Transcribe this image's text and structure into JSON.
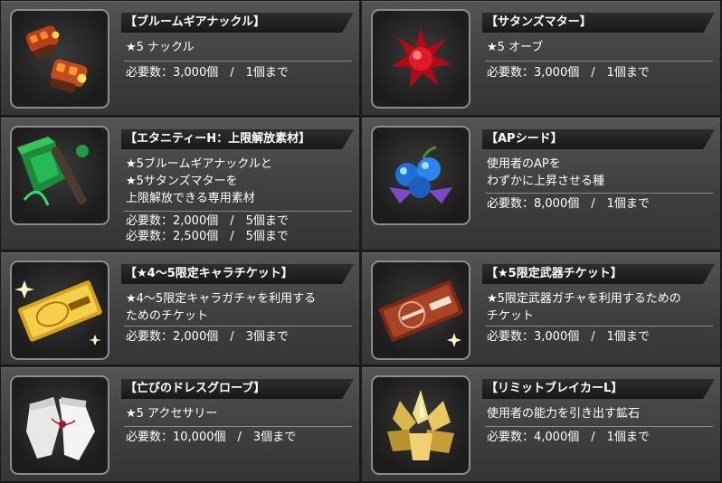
{
  "items": [
    {
      "title": "【ブルームギアナックル】",
      "description": "★5 ナックル",
      "requirements": [
        "必要数：3,000個　/　1個まで"
      ],
      "icon": "knuckle-icon"
    },
    {
      "title": "【サタンズマター】",
      "description": "★5 オーブ",
      "requirements": [
        "必要数：3,000個　/　1個まで"
      ],
      "icon": "red-crystal-orb-icon"
    },
    {
      "title": "【エタニティーH：上限解放素材】",
      "description": "★5ブルームギアナックルと\n★5サタンズマターを\n上限解放できる専用素材",
      "requirements": [
        "必要数：2,000個　/　5個まで",
        "必要数：2,500個　/　5個まで"
      ],
      "icon": "eternity-material-icon"
    },
    {
      "title": "【APシード】",
      "description": "使用者のAPを\nわずかに上昇させる種",
      "requirements": [
        "必要数：8,000個　/　1個まで"
      ],
      "icon": "ap-seed-icon"
    },
    {
      "title": "【★4～5限定キャラチケット】",
      "description": "★4～5限定キャラガチャを利用する\nためのチケット",
      "requirements": [
        "必要数：2,000個　/　3個まで"
      ],
      "icon": "gold-ticket-icon"
    },
    {
      "title": "【★5限定武器チケット】",
      "description": "★5限定武器ガチャを利用するための\nチケット",
      "requirements": [
        "必要数：3,000個　/　1個まで"
      ],
      "icon": "weapon-ticket-icon"
    },
    {
      "title": "【亡びのドレスグローブ】",
      "description": "★5 アクセサリー",
      "requirements": [
        "必要数：10,000個　/　3個まで"
      ],
      "icon": "white-gloves-icon"
    },
    {
      "title": "【リミットブレイカーL】",
      "description": "使用者の能力を引き出す鉱石",
      "requirements": [
        "必要数：4,000個　/　1個まで"
      ],
      "icon": "gold-ore-icon"
    }
  ]
}
